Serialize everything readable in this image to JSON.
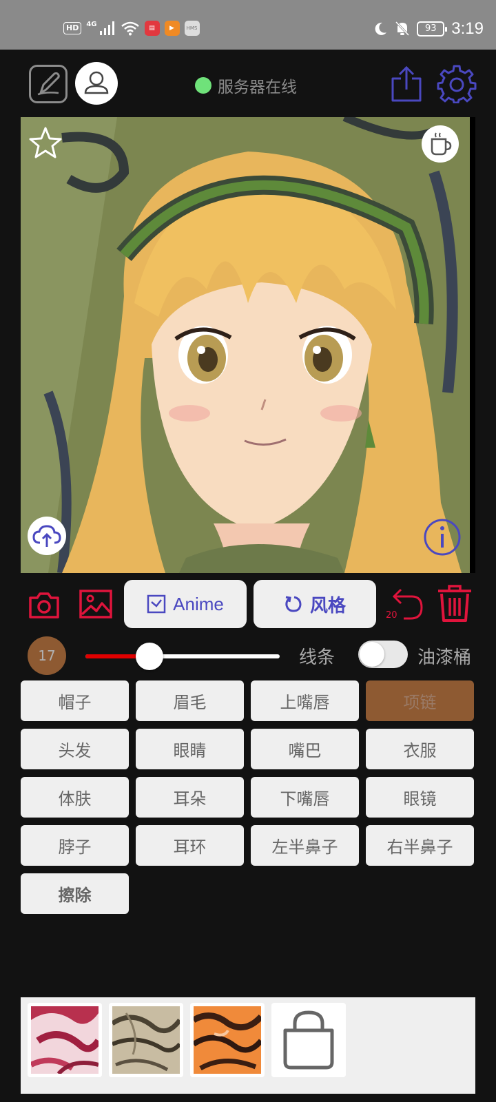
{
  "status_bar": {
    "hd": "HD",
    "network": "4G",
    "battery": "93",
    "time": "3:19",
    "app_badges": [
      "book-app-icon",
      "video-app-icon",
      "hms-app-icon"
    ],
    "hms_label": "HMS"
  },
  "header": {
    "server_status": "服务器在线",
    "server_status_color": "#6fe27a",
    "accent_color": "#4a48c0"
  },
  "canvas": {
    "content": "anime-portrait-image"
  },
  "toolbar": {
    "anime_label": "Anime",
    "style_label": "风格",
    "undo_count": "20",
    "danger_color": "#e0143c"
  },
  "brush": {
    "size": "17",
    "slider_level": 0.33,
    "line_label": "线条",
    "bucket_label": "油漆桶",
    "bucket_enabled": false
  },
  "segments": [
    {
      "label": "帽子",
      "active": false
    },
    {
      "label": "眉毛",
      "active": false
    },
    {
      "label": "上嘴唇",
      "active": false
    },
    {
      "label": "项链",
      "active": true
    },
    {
      "label": "头发",
      "active": false
    },
    {
      "label": "眼睛",
      "active": false
    },
    {
      "label": "嘴巴",
      "active": false
    },
    {
      "label": "衣服",
      "active": false
    },
    {
      "label": "体肤",
      "active": false
    },
    {
      "label": "耳朵",
      "active": false
    },
    {
      "label": "下嘴唇",
      "active": false
    },
    {
      "label": "眼镜",
      "active": false
    },
    {
      "label": "脖子",
      "active": false
    },
    {
      "label": "耳环",
      "active": false
    },
    {
      "label": "左半鼻子",
      "active": false
    },
    {
      "label": "右半鼻子",
      "active": false
    },
    {
      "label": "擦除",
      "active": false,
      "bold": true
    }
  ],
  "textures": [
    "pink-texture",
    "sepia-texture",
    "orange-texture"
  ]
}
